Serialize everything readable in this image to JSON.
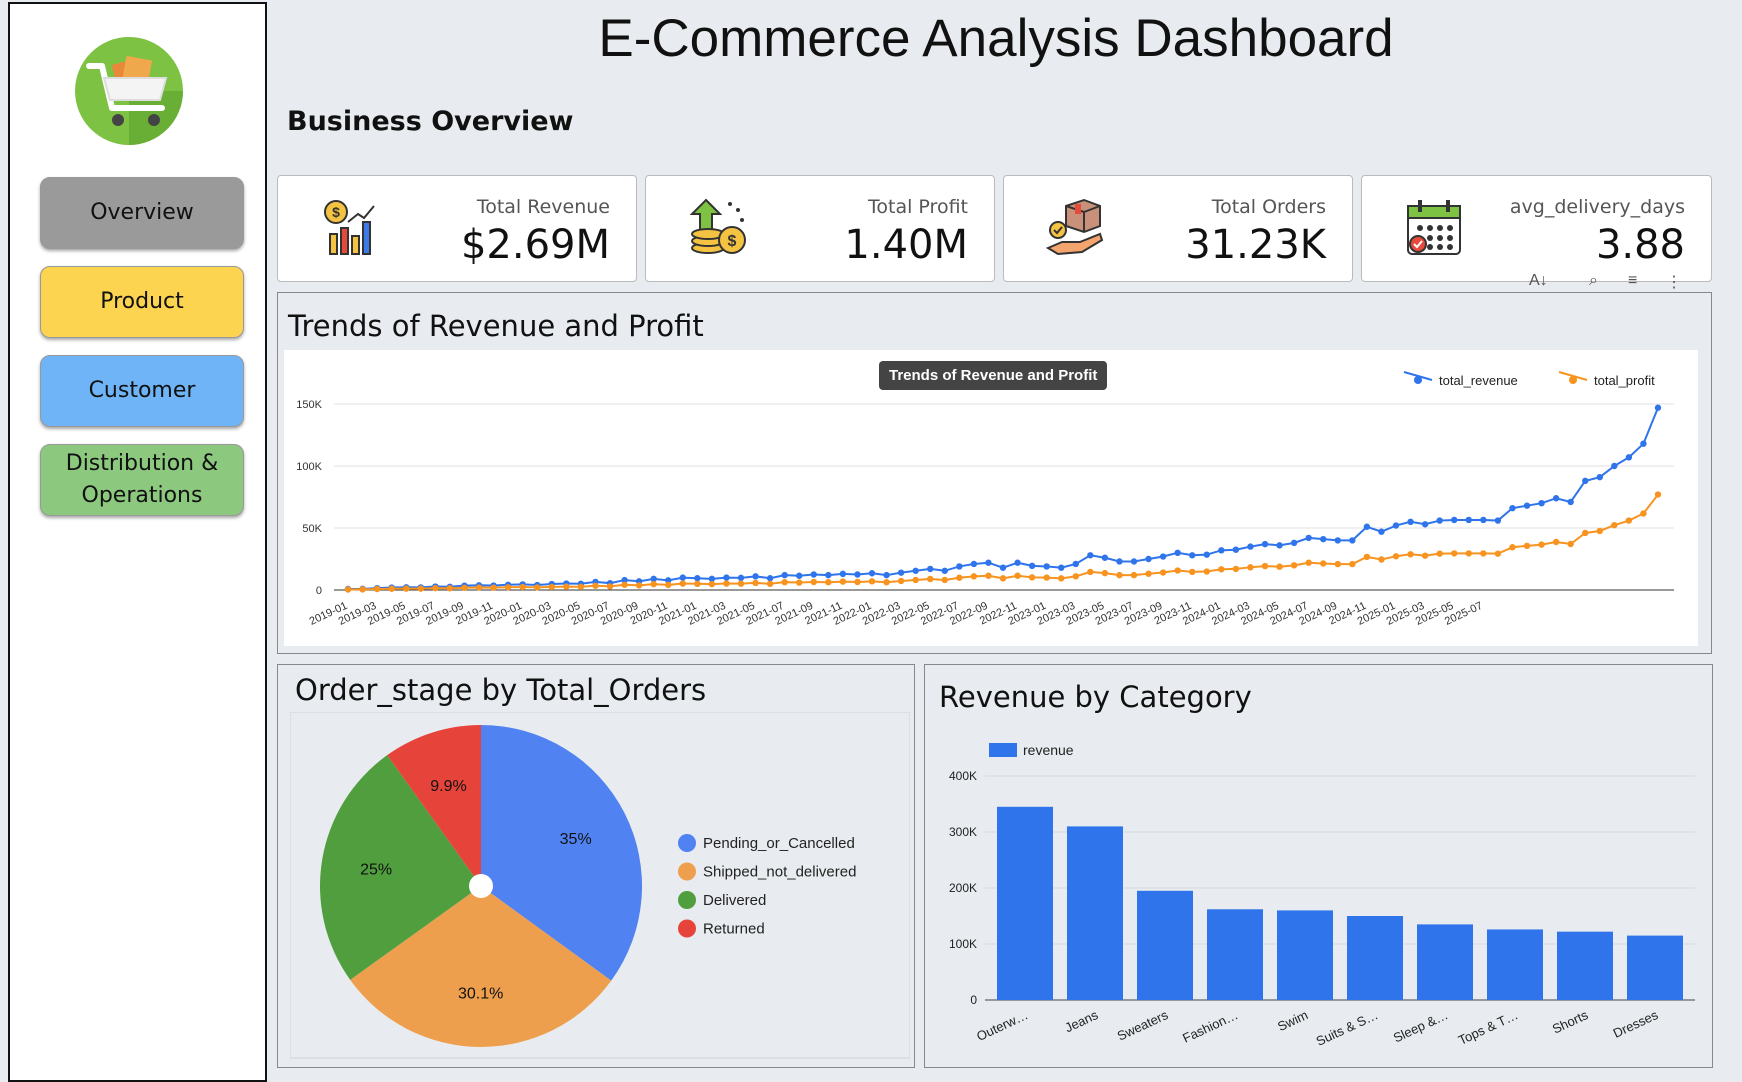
{
  "title": "E-Commerce Analysis Dashboard",
  "section_title": "Business Overview",
  "sidebar": {
    "items": [
      {
        "label": "Overview",
        "color": "#9a9a9a"
      },
      {
        "label": "Product",
        "color": "#fcd44f"
      },
      {
        "label": "Customer",
        "color": "#6fb4f7"
      },
      {
        "label": "Distribution & Operations",
        "color": "#8cc97f"
      }
    ]
  },
  "kpis": [
    {
      "label": "Total Revenue",
      "value": "$2.69M",
      "icon": "revenue-chart-icon"
    },
    {
      "label": "Total Profit",
      "value": "1.40M",
      "icon": "coins-growth-icon"
    },
    {
      "label": "Total Orders",
      "value": "31.23K",
      "icon": "package-hand-icon"
    },
    {
      "label": "avg_delivery_days",
      "value": "3.88",
      "icon": "calendar-icon"
    }
  ],
  "line_panel": {
    "title": "Trends of Revenue and Profit",
    "tooltip": "Trends of Revenue and Profit"
  },
  "pie_panel": {
    "title": "Order_stage by Total_Orders"
  },
  "bar_panel": {
    "title": "Revenue by Category"
  },
  "colors": {
    "revenue": "#2f74eb",
    "profit": "#f7931e",
    "bar": "#2f74eb"
  },
  "chart_data": [
    {
      "type": "line",
      "title": "Trends of Revenue and Profit",
      "ylim": [
        0,
        150000
      ],
      "yticks": [
        "0",
        "50K",
        "100K",
        "150K"
      ],
      "xtick_labels": [
        "2019-01",
        "2019-03",
        "2019-05",
        "2019-07",
        "2019-09",
        "2019-11",
        "2020-01",
        "2020-03",
        "2020-05",
        "2020-07",
        "2020-09",
        "2020-11",
        "2021-01",
        "2021-03",
        "2021-05",
        "2021-07",
        "2021-09",
        "2021-11",
        "2022-01",
        "2022-03",
        "2022-05",
        "2022-07",
        "2022-09",
        "2022-11",
        "2023-01",
        "2023-03",
        "2023-05",
        "2023-07",
        "2023-09",
        "2023-11",
        "2024-01",
        "2024-03",
        "2024-05",
        "2024-07",
        "2024-09",
        "2024-11",
        "2025-01",
        "2025-03",
        "2025-05",
        "2025-07"
      ],
      "legend_position": "top-right",
      "series": [
        {
          "name": "total_revenue",
          "values": [
            800,
            900,
            1500,
            2000,
            2200,
            2100,
            2800,
            2600,
            3500,
            3800,
            3600,
            4200,
            4500,
            4000,
            4800,
            5200,
            5000,
            6500,
            5500,
            8000,
            7000,
            9000,
            7800,
            10000,
            9500,
            9000,
            10000,
            9800,
            11000,
            9500,
            12000,
            11500,
            12500,
            12000,
            13000,
            12500,
            13500,
            12000,
            14000,
            15500,
            17000,
            15500,
            19000,
            21000,
            22000,
            18000,
            22000,
            19500,
            19000,
            18000,
            21000,
            28000,
            26000,
            23000,
            23000,
            25000,
            27000,
            30000,
            28000,
            28500,
            32000,
            32500,
            35000,
            37000,
            36000,
            38000,
            42000,
            41000,
            40000,
            40000,
            51000,
            47000,
            52000,
            55000,
            53000,
            56000,
            56500,
            56500,
            56500,
            56000,
            66000,
            68000,
            70000,
            74000,
            71000,
            88000,
            91000,
            100000,
            107000,
            118000,
            147000
          ]
        },
        {
          "name": "total_profit",
          "values": [
            400,
            500,
            800,
            1000,
            1100,
            1100,
            1500,
            1400,
            1800,
            2000,
            1900,
            2200,
            2400,
            2100,
            2500,
            2700,
            2600,
            3400,
            2900,
            4200,
            3700,
            4700,
            4100,
            5200,
            5000,
            4700,
            5200,
            5100,
            5700,
            5000,
            6300,
            6000,
            6500,
            6300,
            6800,
            6500,
            7000,
            6300,
            7300,
            8100,
            8900,
            8100,
            9900,
            11000,
            11500,
            9400,
            11500,
            10200,
            10000,
            9400,
            11000,
            14600,
            13600,
            12000,
            12000,
            13100,
            14100,
            15700,
            14600,
            14900,
            16700,
            17000,
            18300,
            19300,
            18800,
            19900,
            22000,
            21400,
            20900,
            20900,
            26700,
            24600,
            27200,
            28800,
            27700,
            29300,
            29500,
            29500,
            29500,
            29300,
            34500,
            35600,
            36600,
            38700,
            37100,
            46000,
            47600,
            52300,
            56000,
            61700,
            77000
          ]
        }
      ]
    },
    {
      "type": "pie",
      "title": "Order_stage by Total_Orders",
      "labels": [
        "Pending_or_Cancelled",
        "Shipped_not_delivered",
        "Delivered",
        "Returned"
      ],
      "values": [
        35,
        30.1,
        25,
        9.9
      ],
      "display_labels": [
        "35%",
        "30.1%",
        "25%",
        "9.9%"
      ],
      "colors": [
        "#5082f2",
        "#ee9f4d",
        "#519e3e",
        "#e6443a"
      ],
      "legend_position": "right"
    },
    {
      "type": "bar",
      "title": "Revenue by Category",
      "categories": [
        "Outerw…",
        "Jeans",
        "Sweaters",
        "Fashion…",
        "Swim",
        "Suits & S…",
        "Sleep &…",
        "Tops & T…",
        "Shorts",
        "Dresses"
      ],
      "series": [
        {
          "name": "revenue",
          "values": [
            345000,
            310000,
            195000,
            162000,
            160000,
            150000,
            135000,
            126000,
            122000,
            115000
          ]
        }
      ],
      "ylim": [
        0,
        400000
      ],
      "yticks": [
        "0",
        "100K",
        "200K",
        "300K",
        "400K"
      ],
      "legend_position": "top-left"
    }
  ]
}
